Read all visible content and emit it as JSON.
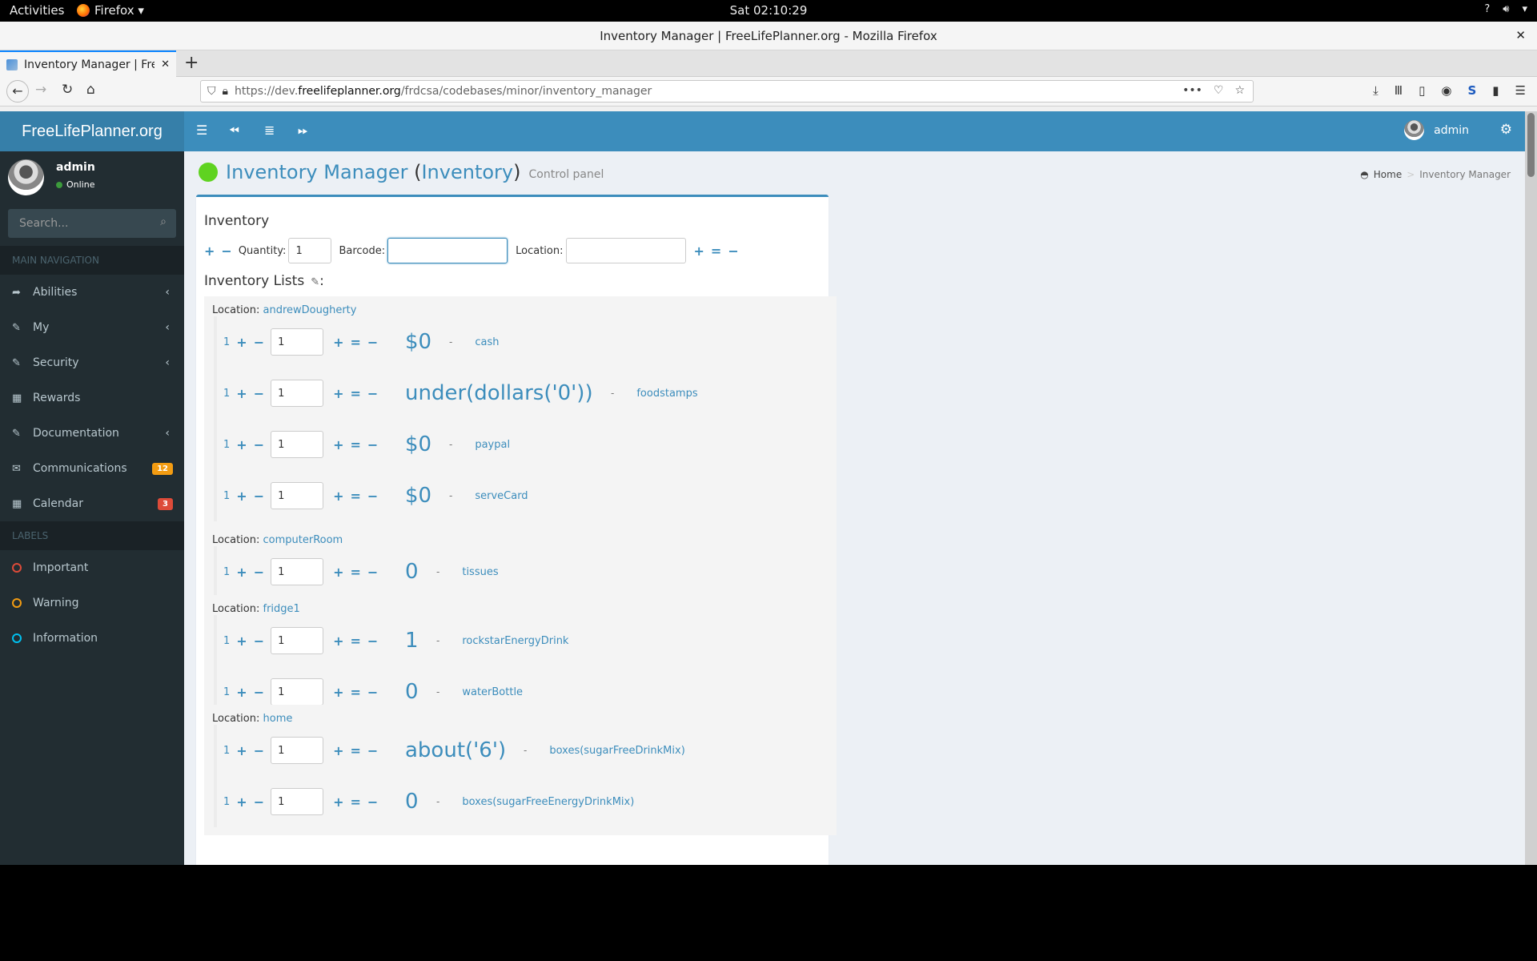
{
  "desktop": {
    "activities": "Activities",
    "app_menu": "Firefox ▾",
    "clock": "Sat 02:10:29",
    "tray_icons": [
      "network-question-icon",
      "volume-icon",
      "system-menu-arrow-icon"
    ]
  },
  "browser": {
    "window_title": "Inventory Manager | FreeLifePlanner.org - Mozilla Firefox",
    "tab_title": "Inventory Manager | Free",
    "url_prefix": "https://dev.",
    "url_domain": "freelifeplanner.org",
    "url_path": "/frdcsa/codebases/minor/inventory_manager"
  },
  "sidebar": {
    "logo": "FreeLifePlanner.org",
    "user_name": "admin",
    "user_status": "Online",
    "search_placeholder": "Search...",
    "main_nav_header": "MAIN NAVIGATION",
    "items": [
      {
        "label": "Abilities",
        "icon": "share-icon",
        "chevron": true
      },
      {
        "label": "My",
        "icon": "edit-icon",
        "chevron": true
      },
      {
        "label": "Security",
        "icon": "edit-icon",
        "chevron": true
      },
      {
        "label": "Rewards",
        "icon": "calendar-icon",
        "chevron": false
      },
      {
        "label": "Documentation",
        "icon": "edit-icon",
        "chevron": true
      },
      {
        "label": "Communications",
        "icon": "envelope-icon",
        "badge": "12",
        "badge_color": "#f39c12"
      },
      {
        "label": "Calendar",
        "icon": "calendar-icon",
        "badge": "3",
        "badge_color": "#dd4b39"
      }
    ],
    "labels_header": "LABELS",
    "labels": [
      {
        "label": "Important",
        "color": "#dd4b39"
      },
      {
        "label": "Warning",
        "color": "#f39c12"
      },
      {
        "label": "Information",
        "color": "#00c0ef"
      }
    ]
  },
  "header": {
    "user_name": "admin"
  },
  "page": {
    "title_main": "Inventory Manager",
    "title_paren_open": " (",
    "title_link": "Inventory",
    "title_paren_close": ")",
    "subtitle": "Control panel",
    "breadcrumb_home": "Home",
    "breadcrumb_sep": ">",
    "breadcrumb_current": "Inventory Manager"
  },
  "inventory": {
    "heading": "Inventory",
    "plus": "+",
    "minus": "−",
    "equals": "=",
    "quantity_label": "Quantity:",
    "quantity_value": "1",
    "barcode_label": "Barcode:",
    "barcode_value": "",
    "location_label": "Location:",
    "location_value": "",
    "lists_heading": "Inventory Lists",
    "lists_suffix": ":"
  },
  "locations": [
    {
      "prefix": "Location: ",
      "name": "andrewDougherty",
      "items": [
        {
          "count": "1",
          "qty": "1",
          "value": "$0",
          "name": "cash"
        },
        {
          "count": "1",
          "qty": "1",
          "value": "under(dollars('0'))",
          "name": "foodstamps"
        },
        {
          "count": "1",
          "qty": "1",
          "value": "$0",
          "name": "paypal"
        },
        {
          "count": "1",
          "qty": "1",
          "value": "$0",
          "name": "serveCard"
        }
      ]
    },
    {
      "prefix": "Location: ",
      "name": "computerRoom",
      "items": [
        {
          "count": "1",
          "qty": "1",
          "value": "0",
          "name": "tissues"
        }
      ]
    },
    {
      "prefix": "Location: ",
      "name": "fridge1",
      "items": [
        {
          "count": "1",
          "qty": "1",
          "value": "1",
          "name": "rockstarEnergyDrink"
        },
        {
          "count": "1",
          "qty": "1",
          "value": "0",
          "name": "waterBottle"
        }
      ]
    },
    {
      "prefix": "Location: ",
      "name": "home",
      "items": [
        {
          "count": "1",
          "qty": "1",
          "value": "about('6')",
          "name": "boxes(sugarFreeDrinkMix)"
        },
        {
          "count": "1",
          "qty": "1",
          "value": "0",
          "name": "boxes(sugarFreeEnergyDrinkMix)"
        }
      ]
    }
  ],
  "row_dash": "-",
  "colors": {
    "brand": "#3c8dbc",
    "logo_bg": "#367fa9",
    "sidebar_bg": "#222d32",
    "status_dot": "#5fd320"
  }
}
